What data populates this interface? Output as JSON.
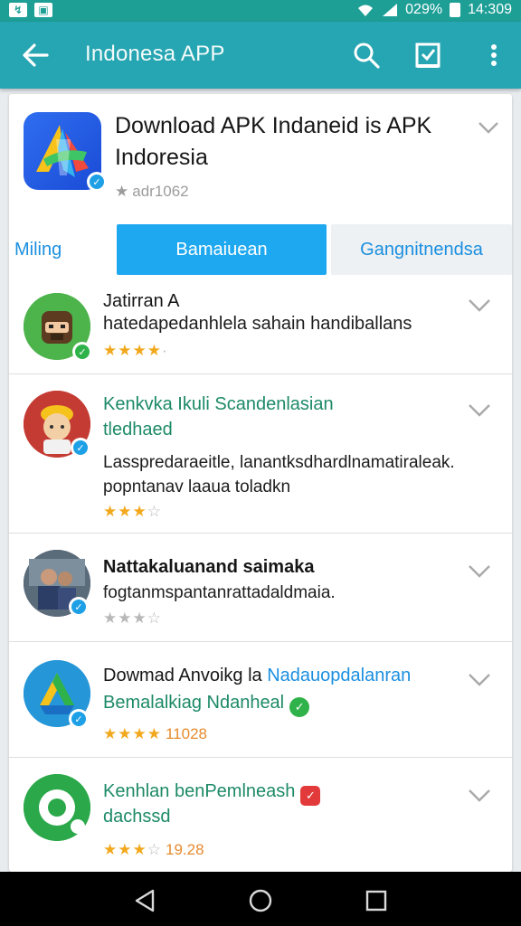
{
  "status_bar": {
    "battery_text": "029%",
    "time": "14:309"
  },
  "app_bar": {
    "title": "Indonesa APP",
    "icons": [
      "back-arrow-icon",
      "search-icon",
      "checkbox-icon",
      "more-vert-icon"
    ]
  },
  "hero": {
    "title": "Download APK Indaneid is  APK Indoresia",
    "rating_text": "adr1062",
    "rating_stars": 1,
    "colors": {
      "icon_bg": "#2f6ef0",
      "badge": "#1ea0e6"
    }
  },
  "tabs": [
    {
      "label": "Miling"
    },
    {
      "label": "Bamaiuean"
    },
    {
      "label": "Gangnitnendsa"
    }
  ],
  "list": [
    {
      "title": "Jatirran A",
      "description": "hatedapedanhlela sahain handiballans",
      "stars_filled": 4,
      "stars_total": 4,
      "count": ""
    },
    {
      "title": "Kenkvka Ikuli Scandenlasian",
      "subtitle": "tledhaed",
      "description": "Lasspredaraeitle, lanantksdhardlnamatiraleak. popntanav laaua toladkn",
      "stars_filled": 3,
      "stars_total": 4,
      "count": ""
    },
    {
      "title": "Nattakaluanand saimaka",
      "description": "fogtanmspantanrattadaldmaia.",
      "stars_filled": 0,
      "stars_total": 4,
      "count": ""
    },
    {
      "title": "Dowmad Anvoikg la",
      "title_extra": " Nadauopdalanran",
      "subtitle": "Bemalalkiag Ndanheal",
      "stars_filled": 4,
      "stars_total": 4,
      "count": "11028"
    },
    {
      "title": "Kenhlan benPemlneash",
      "subtitle": "dachssd",
      "stars_filled": 3,
      "stars_total": 4,
      "count": "19.28"
    }
  ],
  "nav_bar": {
    "icons": [
      "back-triangle-icon",
      "home-circle-icon",
      "recents-square-icon"
    ]
  }
}
